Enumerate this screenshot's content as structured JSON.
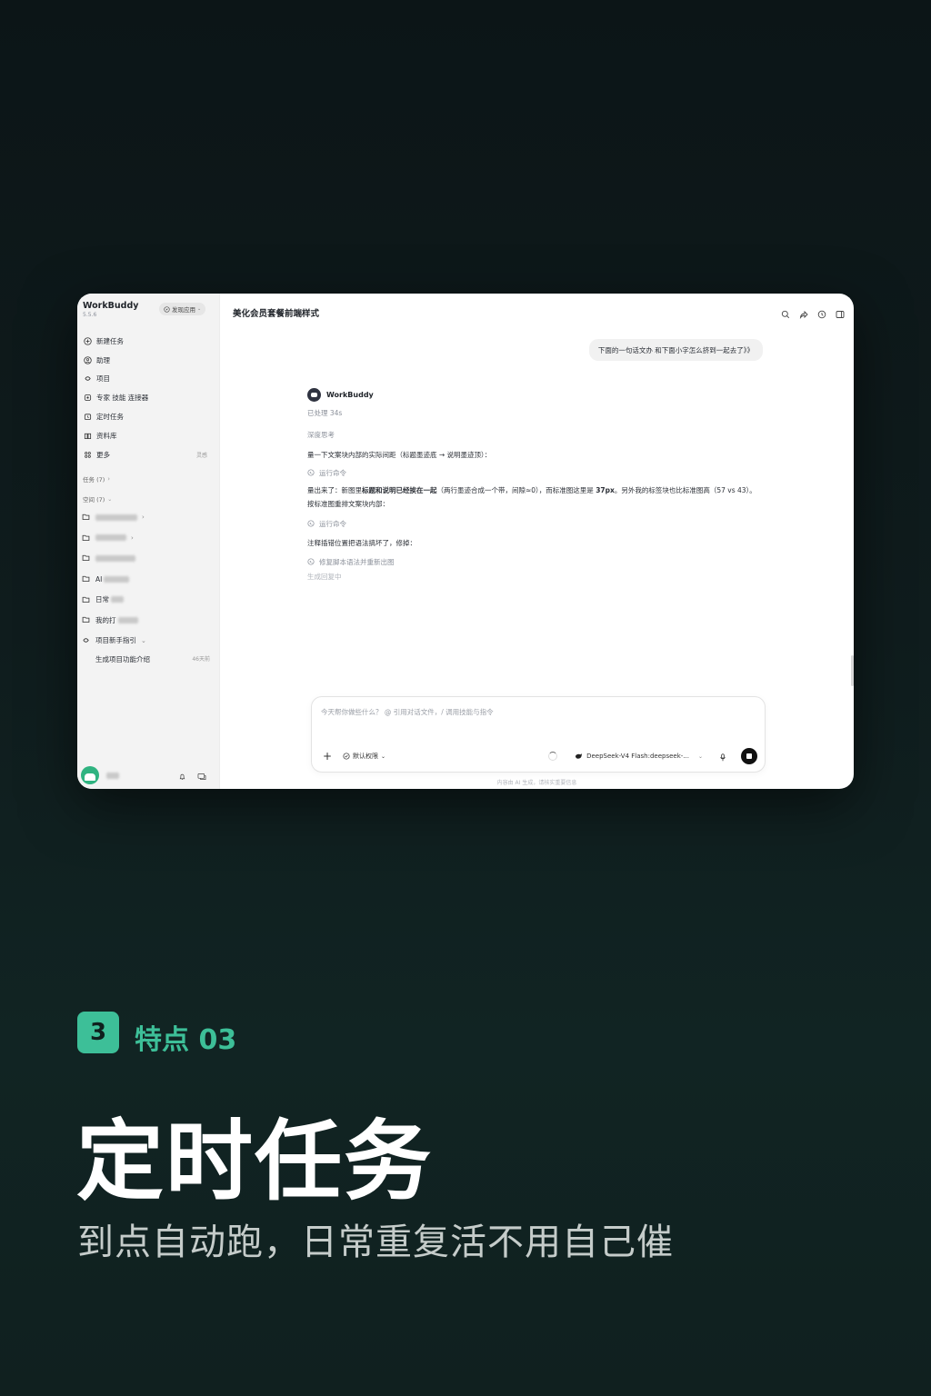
{
  "app": {
    "name": "WorkBuddy",
    "version": "5.5.6",
    "publish_button": "发现应用"
  },
  "sidebar": {
    "nav": [
      {
        "label": "新建任务",
        "icon": "plus-circle-icon"
      },
      {
        "label": "助理",
        "icon": "assistant-icon"
      },
      {
        "label": "项目",
        "icon": "project-icon"
      },
      {
        "label": "专家 技能 连接器",
        "icon": "expert-icon"
      },
      {
        "label": "定时任务",
        "icon": "clock-icon"
      },
      {
        "label": "资料库",
        "icon": "book-icon"
      },
      {
        "label": "更多",
        "icon": "grid-icon",
        "badge": "灵感"
      }
    ],
    "tasks_label": "任务 (7)",
    "spaces_label": "空间 (7)",
    "spaces": [
      {
        "label": "",
        "has_chevron": true
      },
      {
        "label": "",
        "has_chevron": true
      },
      {
        "label": "",
        "has_chevron": false
      },
      {
        "label": "AI",
        "has_chevron": false
      },
      {
        "label": "日常",
        "has_chevron": false
      },
      {
        "label": "我的打",
        "has_chevron": false
      },
      {
        "label": "项目新手指引",
        "has_chevron": true
      }
    ],
    "sub_item": {
      "label": "生成项目功能介绍",
      "time": "46天前"
    }
  },
  "main": {
    "title": "美化会员套餐前端样式",
    "user_message": "下面的一句话文办 和下面小字怎么挤到一起去了》》",
    "bot_name": "WorkBuddy",
    "processed": "已处理 34s",
    "thinking": "深度思考",
    "para1": "量一下文案块内部的实际间距（标题墨迹底 → 说明墨迹顶）：",
    "cmd1": "运行命令",
    "para2_a": "量出来了：新图里",
    "para2_b": "标题和说明已经挨在一起",
    "para2_c": "（两行墨迹合成一个带，间隙≈0），而标准图这里是 ",
    "para2_d": "37px",
    "para2_e": "。另外我的标签块也比标准图高（57 vs 43）。按标准图重排文案块内部：",
    "cmd2": "运行命令",
    "para3": "注释插错位置把语法搞坏了，修掉：",
    "cmd3": "修复脚本语法并重新出图",
    "generating": "生成回复中",
    "input_placeholder": "今天帮你做些什么？ @ 引用对话文件，/ 调用技能与指令",
    "permission": "默认权限",
    "model": "DeepSeek-V4 Flash:deepseek-...",
    "footer_note": "内容由 AI 生成，请核实重要信息"
  },
  "feature": {
    "number": "3",
    "label": "特点 03",
    "headline": "定时任务",
    "subline": "到点自动跑，日常重复活不用自己催"
  },
  "colors": {
    "accent": "#3dbf98",
    "background": "#0f1c1d"
  }
}
